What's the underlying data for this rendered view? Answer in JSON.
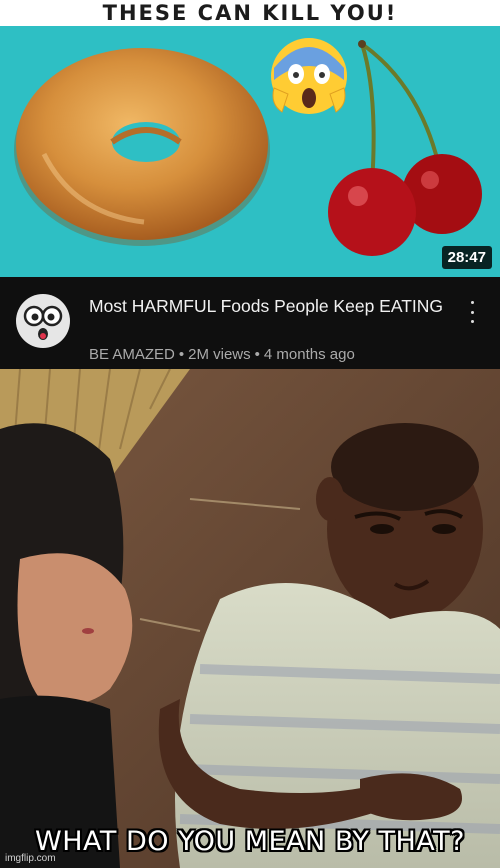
{
  "thumbnail": {
    "banner_text": "THESE CAN KILL YOU!",
    "duration": "28:47",
    "background_color": "#2ebfc4"
  },
  "video": {
    "title": "Most HARMFUL Foods People Keep EATING",
    "channel": "BE AMAZED",
    "separator": "•",
    "views": "2M views",
    "age": "4 months ago"
  },
  "icons": {
    "overflow_menu": "more-vertical-icon",
    "channel_avatar": "cartoon-eyes-face",
    "emoji": "screaming-face-emoji"
  },
  "meme": {
    "caption": "WHAT DO YOU MEAN BY THAT?",
    "watermark": "imgflip.com"
  }
}
